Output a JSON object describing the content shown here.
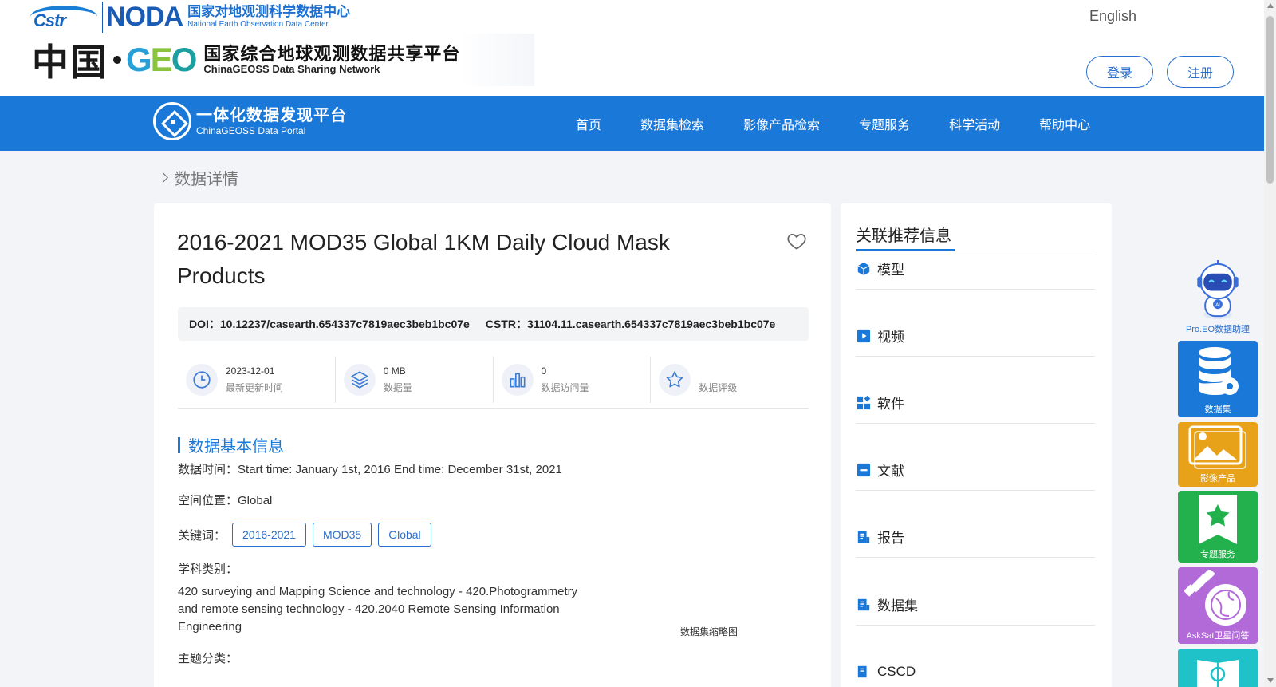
{
  "header": {
    "logo_cstr": "Cstr",
    "logo_noda": "NODA",
    "noda_cn": "国家对地观测科学数据中心",
    "noda_en": "National Earth Observation Data Center",
    "zg": "中国",
    "geo": "GEO",
    "geoss_cn": "国家综合地球观测数据共享平台",
    "geoss_en": "ChinaGEOSS Data Sharing Network",
    "lang": "English",
    "login": "登录",
    "register": "注册"
  },
  "nav": {
    "portal_cn": "一体化数据发现平台",
    "portal_en": "ChinaGEOSS Data Portal",
    "items": [
      "首页",
      "数据集检索",
      "影像产品检索",
      "专题服务",
      "科学活动",
      "帮助中心"
    ]
  },
  "breadcrumb": "数据详情",
  "dataset": {
    "title": "2016-2021 MOD35 Global 1KM Daily Cloud Mask Products",
    "doi_label": "DOI：",
    "doi": "10.12237/casearth.654337c7819aec3beb1bc07e",
    "cstr_label": "CSTR：",
    "cstr": "31104.11.casearth.654337c7819aec3beb1bc07e",
    "stats": [
      {
        "value": "2023-12-01",
        "label": "最新更新时间",
        "icon": "clock-icon"
      },
      {
        "value": "0 MB",
        "label": "数据量",
        "icon": "layers-icon"
      },
      {
        "value": "0",
        "label": "数据访问量",
        "icon": "bar-chart-icon"
      },
      {
        "value": "",
        "label": "数据评级",
        "icon": "star-icon"
      }
    ],
    "section_title": "数据基本信息",
    "time_label": "数据时间：",
    "time_value": "Start time: January 1st, 2016 End time: December 31st, 2021",
    "space_label": "空间位置：",
    "space_value": "Global",
    "keywords_label": "关键词：",
    "keywords": [
      "2016-2021",
      "MOD35",
      "Global"
    ],
    "subject_label": "学科类别：",
    "subject_value": "420 surveying and Mapping Science and technology - 420.Photogrammetry and remote sensing technology - 420.2040 Remote Sensing Information Engineering",
    "thumb_label": "数据集缩略图",
    "topic_label": "主题分类："
  },
  "side": {
    "title": "关联推荐信息",
    "items": [
      {
        "label": "模型",
        "icon": "cube-icon"
      },
      {
        "label": "视频",
        "icon": "play-icon"
      },
      {
        "label": "软件",
        "icon": "apps-icon"
      },
      {
        "label": "文献",
        "icon": "document-icon"
      },
      {
        "label": "报告",
        "icon": "report-icon"
      },
      {
        "label": "数据集",
        "icon": "dataset-icon"
      },
      {
        "label": "CSCD",
        "icon": "cscd-icon"
      }
    ]
  },
  "float": {
    "assistant": "Pro.EO数据助理",
    "robot_badge": "AI",
    "dataset": "数据集",
    "image": "影像产品",
    "topic": "专题服务",
    "asksat": "AskSat卫星问答"
  },
  "colors": {
    "primary": "#1a78d8",
    "dataset_tile": "#1a78d8",
    "image_tile": "#e8a21a",
    "topic_tile": "#22b14c",
    "asksat_tile": "#b36ad9",
    "bottom_tile": "#20c2c9"
  }
}
